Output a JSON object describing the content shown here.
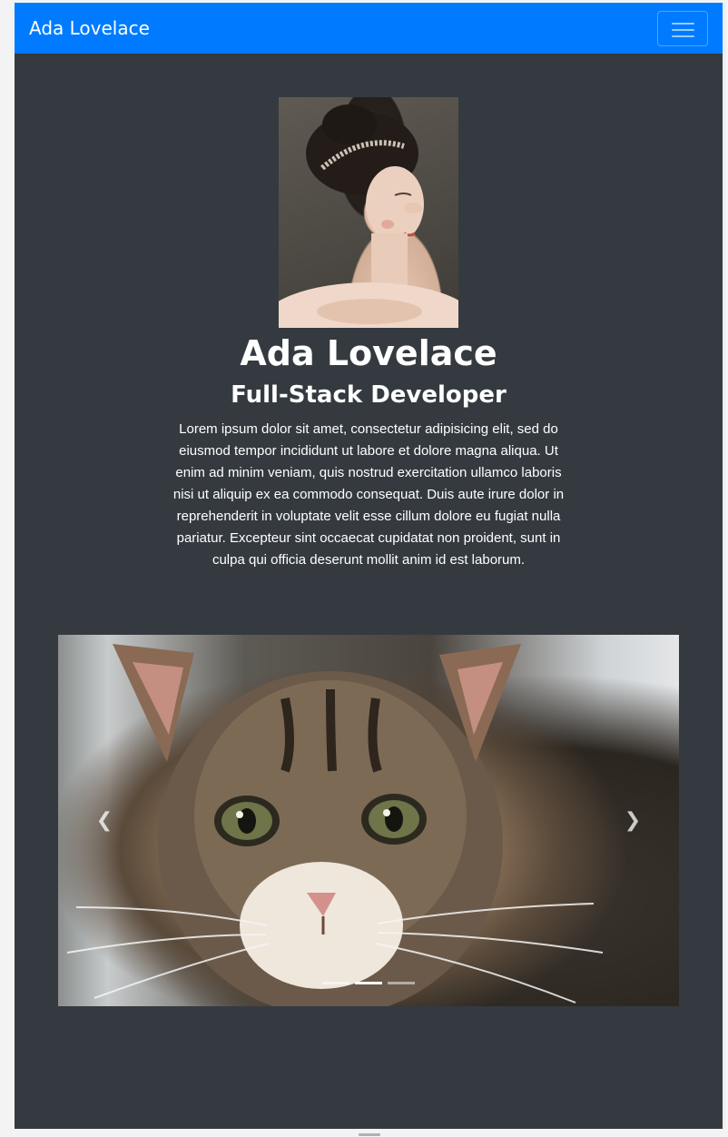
{
  "navbar": {
    "brand": "Ada Lovelace",
    "toggler_icon": "hamburger-menu-icon",
    "color": "#007bff"
  },
  "hero": {
    "portrait_alt": "Portrait of Ada Lovelace",
    "name": "Ada Lovelace",
    "role": "Full-Stack Developer",
    "bio": "Lorem ipsum dolor sit amet, consectetur adipisicing elit, sed do eiusmod tempor incididunt ut labore et dolore magna aliqua. Ut enim ad minim veniam, quis nostrud exercitation ullamco laboris nisi ut aliquip ex ea commodo consequat. Duis aute irure dolor in reprehenderit in voluptate velit esse cillum dolore eu fugiat nulla pariatur. Excepteur sint occaecat cupidatat non proident, sunt in culpa qui officia deserunt mollit anim id est laborum."
  },
  "carousel": {
    "slide_alt": "Kitten",
    "prev_icon": "chevron-left-icon",
    "next_icon": "chevron-right-icon",
    "slide_count": 3,
    "active_index": 1
  },
  "colors": {
    "page_background": "#343a40",
    "text": "#ffffff"
  }
}
